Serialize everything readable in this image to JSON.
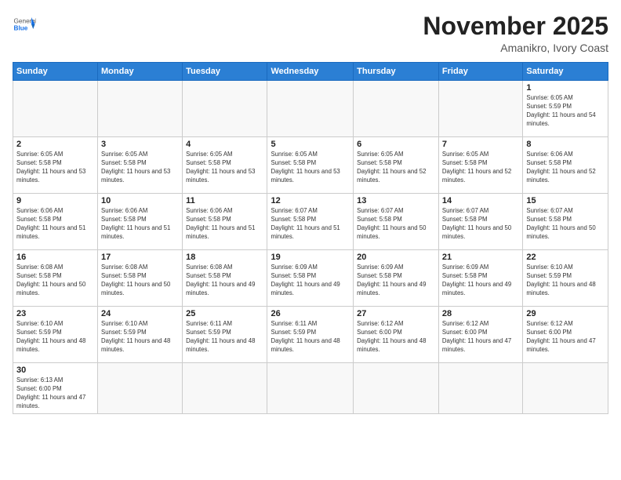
{
  "header": {
    "logo_general": "General",
    "logo_blue": "Blue",
    "month_title": "November 2025",
    "location": "Amanikro, Ivory Coast"
  },
  "days_of_week": [
    "Sunday",
    "Monday",
    "Tuesday",
    "Wednesday",
    "Thursday",
    "Friday",
    "Saturday"
  ],
  "weeks": [
    [
      {
        "day": "",
        "info": ""
      },
      {
        "day": "",
        "info": ""
      },
      {
        "day": "",
        "info": ""
      },
      {
        "day": "",
        "info": ""
      },
      {
        "day": "",
        "info": ""
      },
      {
        "day": "",
        "info": ""
      },
      {
        "day": "1",
        "sunrise": "6:05 AM",
        "sunset": "5:59 PM",
        "daylight": "11 hours and 54 minutes."
      }
    ],
    [
      {
        "day": "2",
        "sunrise": "6:05 AM",
        "sunset": "5:58 PM",
        "daylight": "11 hours and 53 minutes."
      },
      {
        "day": "3",
        "sunrise": "6:05 AM",
        "sunset": "5:58 PM",
        "daylight": "11 hours and 53 minutes."
      },
      {
        "day": "4",
        "sunrise": "6:05 AM",
        "sunset": "5:58 PM",
        "daylight": "11 hours and 53 minutes."
      },
      {
        "day": "5",
        "sunrise": "6:05 AM",
        "sunset": "5:58 PM",
        "daylight": "11 hours and 53 minutes."
      },
      {
        "day": "6",
        "sunrise": "6:05 AM",
        "sunset": "5:58 PM",
        "daylight": "11 hours and 52 minutes."
      },
      {
        "day": "7",
        "sunrise": "6:05 AM",
        "sunset": "5:58 PM",
        "daylight": "11 hours and 52 minutes."
      },
      {
        "day": "8",
        "sunrise": "6:06 AM",
        "sunset": "5:58 PM",
        "daylight": "11 hours and 52 minutes."
      }
    ],
    [
      {
        "day": "9",
        "sunrise": "6:06 AM",
        "sunset": "5:58 PM",
        "daylight": "11 hours and 51 minutes."
      },
      {
        "day": "10",
        "sunrise": "6:06 AM",
        "sunset": "5:58 PM",
        "daylight": "11 hours and 51 minutes."
      },
      {
        "day": "11",
        "sunrise": "6:06 AM",
        "sunset": "5:58 PM",
        "daylight": "11 hours and 51 minutes."
      },
      {
        "day": "12",
        "sunrise": "6:07 AM",
        "sunset": "5:58 PM",
        "daylight": "11 hours and 51 minutes."
      },
      {
        "day": "13",
        "sunrise": "6:07 AM",
        "sunset": "5:58 PM",
        "daylight": "11 hours and 50 minutes."
      },
      {
        "day": "14",
        "sunrise": "6:07 AM",
        "sunset": "5:58 PM",
        "daylight": "11 hours and 50 minutes."
      },
      {
        "day": "15",
        "sunrise": "6:07 AM",
        "sunset": "5:58 PM",
        "daylight": "11 hours and 50 minutes."
      }
    ],
    [
      {
        "day": "16",
        "sunrise": "6:08 AM",
        "sunset": "5:58 PM",
        "daylight": "11 hours and 50 minutes."
      },
      {
        "day": "17",
        "sunrise": "6:08 AM",
        "sunset": "5:58 PM",
        "daylight": "11 hours and 50 minutes."
      },
      {
        "day": "18",
        "sunrise": "6:08 AM",
        "sunset": "5:58 PM",
        "daylight": "11 hours and 49 minutes."
      },
      {
        "day": "19",
        "sunrise": "6:09 AM",
        "sunset": "5:58 PM",
        "daylight": "11 hours and 49 minutes."
      },
      {
        "day": "20",
        "sunrise": "6:09 AM",
        "sunset": "5:58 PM",
        "daylight": "11 hours and 49 minutes."
      },
      {
        "day": "21",
        "sunrise": "6:09 AM",
        "sunset": "5:58 PM",
        "daylight": "11 hours and 49 minutes."
      },
      {
        "day": "22",
        "sunrise": "6:10 AM",
        "sunset": "5:59 PM",
        "daylight": "11 hours and 48 minutes."
      }
    ],
    [
      {
        "day": "23",
        "sunrise": "6:10 AM",
        "sunset": "5:59 PM",
        "daylight": "11 hours and 48 minutes."
      },
      {
        "day": "24",
        "sunrise": "6:10 AM",
        "sunset": "5:59 PM",
        "daylight": "11 hours and 48 minutes."
      },
      {
        "day": "25",
        "sunrise": "6:11 AM",
        "sunset": "5:59 PM",
        "daylight": "11 hours and 48 minutes."
      },
      {
        "day": "26",
        "sunrise": "6:11 AM",
        "sunset": "5:59 PM",
        "daylight": "11 hours and 48 minutes."
      },
      {
        "day": "27",
        "sunrise": "6:12 AM",
        "sunset": "6:00 PM",
        "daylight": "11 hours and 48 minutes."
      },
      {
        "day": "28",
        "sunrise": "6:12 AM",
        "sunset": "6:00 PM",
        "daylight": "11 hours and 47 minutes."
      },
      {
        "day": "29",
        "sunrise": "6:12 AM",
        "sunset": "6:00 PM",
        "daylight": "11 hours and 47 minutes."
      }
    ],
    [
      {
        "day": "30",
        "sunrise": "6:13 AM",
        "sunset": "6:00 PM",
        "daylight": "11 hours and 47 minutes."
      },
      {
        "day": "",
        "info": ""
      },
      {
        "day": "",
        "info": ""
      },
      {
        "day": "",
        "info": ""
      },
      {
        "day": "",
        "info": ""
      },
      {
        "day": "",
        "info": ""
      },
      {
        "day": "",
        "info": ""
      }
    ]
  ]
}
